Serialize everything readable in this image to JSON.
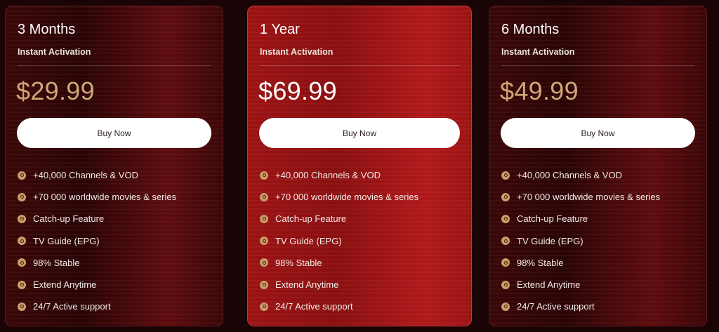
{
  "colors": {
    "background": "#1a0405",
    "card_dark": "#3a0708",
    "card_featured": "#9c1314",
    "price_gold": "#cfa676",
    "icon_gold": "#c79e68",
    "button_bg": "#ffffff"
  },
  "plans": [
    {
      "title": "3 Months",
      "subtitle": "Instant Activation",
      "price": "$29.99",
      "button_label": "Buy Now",
      "featured": false,
      "features": [
        "+40,000 Channels & VOD",
        "+70 000 worldwide movies & series",
        "Catch-up Feature",
        "TV Guide (EPG)",
        "98% Stable",
        "Extend Anytime",
        "24/7 Active support"
      ]
    },
    {
      "title": "1 Year",
      "subtitle": "Instant Activation",
      "price": "$69.99",
      "button_label": "Buy Now",
      "featured": true,
      "features": [
        "+40,000 Channels & VOD",
        "+70 000 worldwide movies & series",
        "Catch-up Feature",
        "TV Guide (EPG)",
        "98% Stable",
        "Extend Anytime",
        "24/7 Active support"
      ]
    },
    {
      "title": "6 Months",
      "subtitle": "Instant Activation",
      "price": "$49.99",
      "button_label": "Buy Now",
      "featured": false,
      "features": [
        "+40,000 Channels & VOD",
        "+70 000 worldwide movies & series",
        "Catch-up Feature",
        "TV Guide (EPG)",
        "98% Stable",
        "Extend Anytime",
        "24/7 Active support"
      ]
    }
  ],
  "feature_icon": "disc-icon"
}
